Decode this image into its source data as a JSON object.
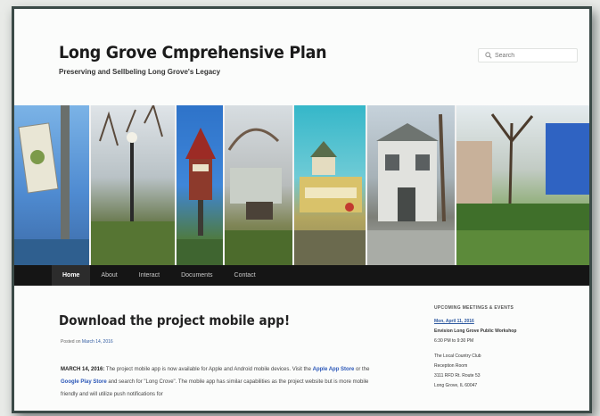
{
  "site": {
    "title": "Long Grove Cmprehensive Plan",
    "tagline": "Preserving and Sellbeling Long Grove's Legacy"
  },
  "search": {
    "placeholder": "Search"
  },
  "nav": {
    "items": [
      {
        "label": "Home",
        "active": true
      },
      {
        "label": "About"
      },
      {
        "label": "Interact"
      },
      {
        "label": "Documents"
      },
      {
        "label": "Contact"
      }
    ]
  },
  "post": {
    "title": "Download the project mobile app!",
    "meta_prefix": "Posted on",
    "meta_date": "March 14, 2016",
    "date_lead": "MARCH 14, 2016:",
    "body_1": " The project mobile app is now available for Apple and Android mobile devices. Visit the ",
    "link_apple": "Apple App Store",
    "body_2": " or the ",
    "link_google": "Google Play Store",
    "body_3": " and search for \"Long Crove\". The mobile app has similar capabilities as the project website but is more mobile friendly and will utilize push notifications for"
  },
  "sidebar": {
    "heading": "UPCOMING MEETINGS & EVENTS",
    "event": {
      "date": "Mon, April 11, 2016",
      "title": "Envision Long Grove Public Workshop",
      "time": "6:30 PM to 9:30 PM",
      "venue": "The Local Country Club",
      "venue2": "Reception Room",
      "address": "3111 RFD Rt. Route 53",
      "city": "Long Grove, IL 60047"
    }
  },
  "colors": {
    "navbar": "#151515",
    "link": "#2b57b8",
    "frame": "#3b4a47"
  }
}
